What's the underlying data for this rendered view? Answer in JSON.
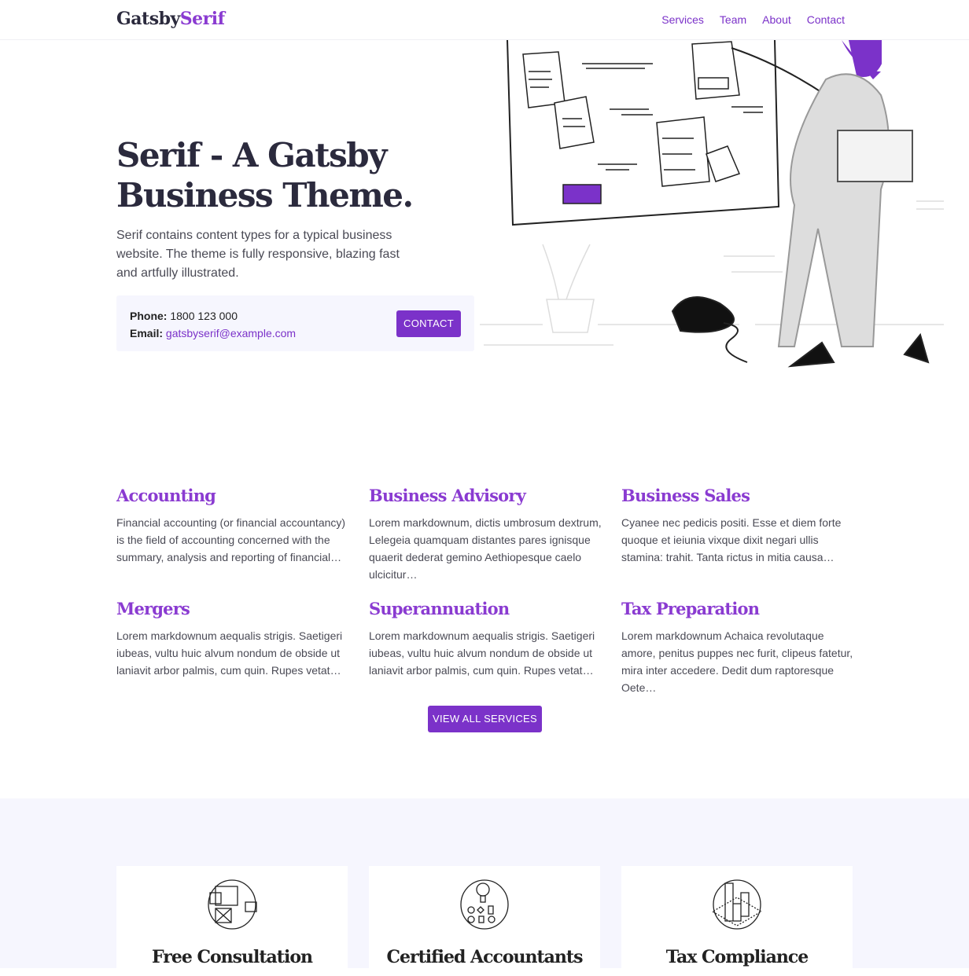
{
  "header": {
    "logo_part1": "Gatsby",
    "logo_part2": "Serif",
    "nav": [
      "Services",
      "Team",
      "About",
      "Contact"
    ]
  },
  "hero": {
    "title": "Serif - A Gatsby Business Theme.",
    "text": "Serif contains content types for a typical business website. The theme is fully responsive, blazing fast and artfully illustrated.",
    "phone_label": "Phone:",
    "phone": "1800 123 000",
    "email_label": "Email:",
    "email": "gatsbyserif@example.com",
    "contact_button": "CONTACT"
  },
  "services": [
    {
      "title": "Accounting",
      "text": "Financial accounting (or financial accountancy) is the field of accounting concerned with the summary, analysis and reporting of financial…"
    },
    {
      "title": "Business Advisory",
      "text": "Lorem markdownum, dictis umbrosum dextrum, Lelegeia quamquam distantes pares ignisque quaerit dederat gemino Aethiopesque caelo ulcicitur…"
    },
    {
      "title": "Business Sales",
      "text": "Cyanee nec pedicis positi. Esse et diem forte quoque et ieiunia vixque dixit negari ullis stamina: trahit. Tanta rictus in mitia causa…"
    },
    {
      "title": "Mergers",
      "text": "Lorem markdownum aequalis strigis. Saetigeri iubeas, vultu huic alvum nondum de obside ut laniavit arbor palmis, cum quin. Rupes vetat…"
    },
    {
      "title": "Superannuation",
      "text": "Lorem markdownum aequalis strigis. Saetigeri iubeas, vultu huic alvum nondum de obside ut laniavit arbor palmis, cum quin. Rupes vetat…"
    },
    {
      "title": "Tax Preparation",
      "text": "Lorem markdownum Achaica revolutaque amore, penitus puppes nec furit, clipeus fatetur, mira inter accedere. Dedit dum raptoresque Oete…"
    }
  ],
  "view_all_button": "VIEW ALL SERVICES",
  "features": [
    {
      "title": "Free Consultation",
      "icon": "consultation-icon"
    },
    {
      "title": "Certified Accountants",
      "icon": "lightbulb-flowchart-icon"
    },
    {
      "title": "Tax Compliance",
      "icon": "buildings-chart-icon"
    }
  ],
  "colors": {
    "accent": "#7b32c9",
    "heading": "#2b2a3d",
    "band": "#f6f6fe"
  }
}
